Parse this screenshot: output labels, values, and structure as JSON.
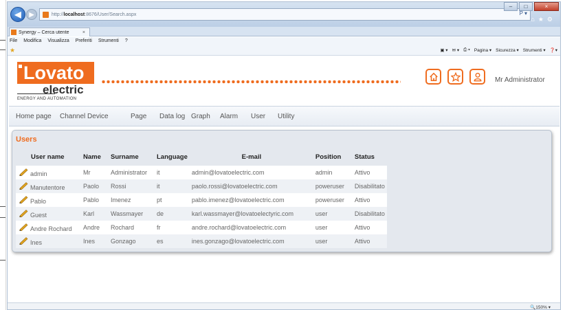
{
  "browser": {
    "address": {
      "prefix": "http://",
      "host": "localhost",
      "path": ":8676/User/Search.aspx"
    },
    "address_tools": "P ▾",
    "tab_title": "Synergy – Cerca utente",
    "tab_close": "×",
    "window_controls": {
      "minimize": "–",
      "maximize": "□",
      "close": "×"
    },
    "menu": [
      "File",
      "Modifica",
      "Visualizza",
      "Preferiti",
      "Strumenti",
      "?"
    ],
    "commandbar": [
      "Pagina ▾",
      "Sicurezza ▾",
      "Strumenti ▾"
    ],
    "zoom": "150%"
  },
  "header": {
    "logo_main": "Lovato",
    "logo_sub": "electric",
    "logo_tagline": "ENERGY AND AUTOMATION",
    "icons": [
      "home-icon",
      "star-icon",
      "user-icon"
    ],
    "user_name": "Mr Administrator",
    "accent_color": "#ef6c1f"
  },
  "nav": [
    "Home page",
    "Channel Device",
    "Page",
    "Data log",
    "Graph",
    "Alarm",
    "User",
    "Utility"
  ],
  "users_panel": {
    "title": "Users",
    "columns": [
      "User name",
      "Name",
      "Surname",
      "Language",
      "E-mail",
      "Position",
      "Status"
    ],
    "rows": [
      [
        "admin",
        "Mr",
        "Administrator",
        "it",
        "admin@lovatoelectric.com",
        "admin",
        "Attivo"
      ],
      [
        "Manutentore",
        "Paolo",
        "Rossi",
        "it",
        "paolo.rossi@lovatoelectric.com",
        "poweruser",
        "Disabilitato"
      ],
      [
        "Pablo",
        "Pablo",
        "Imenez",
        "pt",
        "pablo.imenez@lovatoelectric.com",
        "poweruser",
        "Attivo"
      ],
      [
        "Guest",
        "Karl",
        "Wassmayer",
        "de",
        "karl.wassmayer@lovatoelectyric.com",
        "user",
        "Disabilitato"
      ],
      [
        "Andre Rochard",
        "Andre",
        "Rochard",
        "fr",
        "andre.rochard@lovatoelectric.com",
        "user",
        "Attivo"
      ],
      [
        "Ines",
        "Ines",
        "Gonzago",
        "es",
        "ines.gonzago@lovatoelectric.com",
        "user",
        "Attivo"
      ]
    ]
  }
}
